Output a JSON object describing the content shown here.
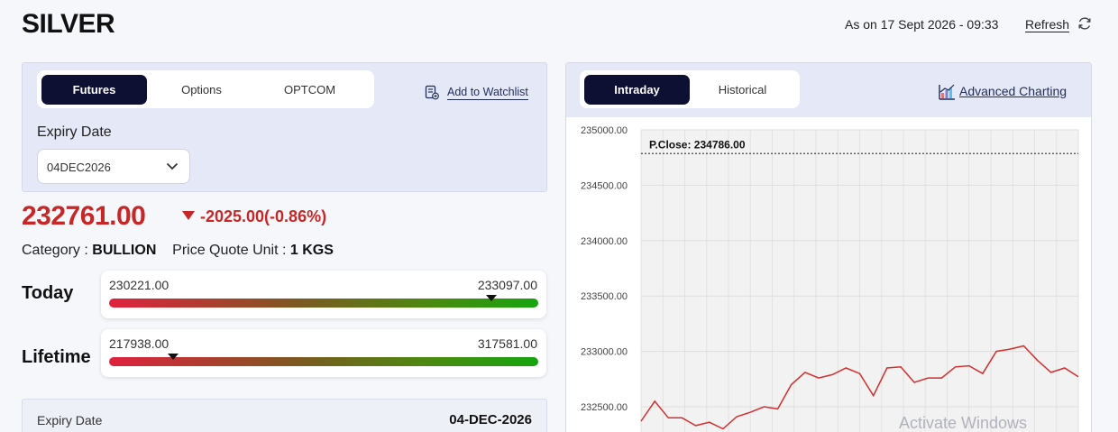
{
  "header": {
    "title": "SILVER",
    "as_on": "As on 17 Sept 2026 - 09:33",
    "refresh": "Refresh"
  },
  "left": {
    "tabs": [
      {
        "label": "Futures",
        "active": true
      },
      {
        "label": "Options",
        "active": false
      },
      {
        "label": "OPTCOM",
        "active": false
      }
    ],
    "watchlist_label": "Add to Watchlist",
    "expiry_label": "Expiry Date",
    "expiry_value": "04DEC2026",
    "price": "232761.00",
    "change": "-2025.00(-0.86%)",
    "category_label": "Category :",
    "category_value": "BULLION",
    "unit_label": "Price Quote Unit :",
    "unit_value": "1 KGS",
    "today": {
      "label": "Today",
      "low": "230221.00",
      "high": "233097.00",
      "marker_fraction": 0.89
    },
    "lifetime": {
      "label": "Lifetime",
      "low": "217938.00",
      "high": "317581.00",
      "marker_fraction": 0.15
    },
    "detail": {
      "key": "Expiry Date",
      "value": "04-DEC-2026"
    }
  },
  "right": {
    "tabs": [
      {
        "label": "Intraday",
        "active": true
      },
      {
        "label": "Historical",
        "active": false
      }
    ],
    "advanced_charting": "Advanced Charting"
  },
  "chart_data": {
    "type": "line",
    "ylim": [
      232450,
      235000
    ],
    "yticks": [
      "235000.00",
      "234500.00",
      "234000.00",
      "233500.00",
      "233000.00",
      "232500.00"
    ],
    "ytick_values": [
      235000,
      234500,
      234000,
      233500,
      233000,
      232500
    ],
    "reference_line": {
      "label": "P.Close: 234786.00",
      "value": 234786
    },
    "grid": true,
    "line_color": "#d32f2f",
    "values": [
      232370,
      232550,
      232400,
      232400,
      232330,
      232360,
      232300,
      232410,
      232450,
      232500,
      232480,
      232700,
      232810,
      232760,
      232790,
      232850,
      232800,
      232600,
      232850,
      232860,
      232720,
      232760,
      232760,
      232860,
      232870,
      232800,
      233000,
      233020,
      233050,
      232920,
      232810,
      232850,
      232770
    ]
  },
  "watermark": "Activate Windows",
  "colors": {
    "accent": "#0d0f33",
    "negative": "#c62828",
    "panel": "#e5e8f6"
  }
}
